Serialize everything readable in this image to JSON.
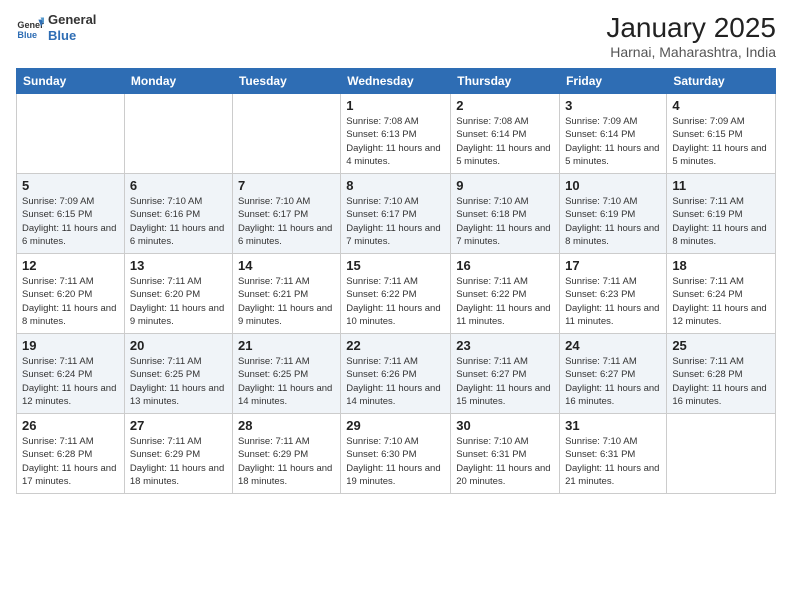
{
  "logo": {
    "general": "General",
    "blue": "Blue"
  },
  "title": "January 2025",
  "subtitle": "Harnai, Maharashtra, India",
  "days_of_week": [
    "Sunday",
    "Monday",
    "Tuesday",
    "Wednesday",
    "Thursday",
    "Friday",
    "Saturday"
  ],
  "weeks": [
    [
      {
        "day": "",
        "info": ""
      },
      {
        "day": "",
        "info": ""
      },
      {
        "day": "",
        "info": ""
      },
      {
        "day": "1",
        "info": "Sunrise: 7:08 AM\nSunset: 6:13 PM\nDaylight: 11 hours and 4 minutes."
      },
      {
        "day": "2",
        "info": "Sunrise: 7:08 AM\nSunset: 6:14 PM\nDaylight: 11 hours and 5 minutes."
      },
      {
        "day": "3",
        "info": "Sunrise: 7:09 AM\nSunset: 6:14 PM\nDaylight: 11 hours and 5 minutes."
      },
      {
        "day": "4",
        "info": "Sunrise: 7:09 AM\nSunset: 6:15 PM\nDaylight: 11 hours and 5 minutes."
      }
    ],
    [
      {
        "day": "5",
        "info": "Sunrise: 7:09 AM\nSunset: 6:15 PM\nDaylight: 11 hours and 6 minutes."
      },
      {
        "day": "6",
        "info": "Sunrise: 7:10 AM\nSunset: 6:16 PM\nDaylight: 11 hours and 6 minutes."
      },
      {
        "day": "7",
        "info": "Sunrise: 7:10 AM\nSunset: 6:17 PM\nDaylight: 11 hours and 6 minutes."
      },
      {
        "day": "8",
        "info": "Sunrise: 7:10 AM\nSunset: 6:17 PM\nDaylight: 11 hours and 7 minutes."
      },
      {
        "day": "9",
        "info": "Sunrise: 7:10 AM\nSunset: 6:18 PM\nDaylight: 11 hours and 7 minutes."
      },
      {
        "day": "10",
        "info": "Sunrise: 7:10 AM\nSunset: 6:19 PM\nDaylight: 11 hours and 8 minutes."
      },
      {
        "day": "11",
        "info": "Sunrise: 7:11 AM\nSunset: 6:19 PM\nDaylight: 11 hours and 8 minutes."
      }
    ],
    [
      {
        "day": "12",
        "info": "Sunrise: 7:11 AM\nSunset: 6:20 PM\nDaylight: 11 hours and 8 minutes."
      },
      {
        "day": "13",
        "info": "Sunrise: 7:11 AM\nSunset: 6:20 PM\nDaylight: 11 hours and 9 minutes."
      },
      {
        "day": "14",
        "info": "Sunrise: 7:11 AM\nSunset: 6:21 PM\nDaylight: 11 hours and 9 minutes."
      },
      {
        "day": "15",
        "info": "Sunrise: 7:11 AM\nSunset: 6:22 PM\nDaylight: 11 hours and 10 minutes."
      },
      {
        "day": "16",
        "info": "Sunrise: 7:11 AM\nSunset: 6:22 PM\nDaylight: 11 hours and 11 minutes."
      },
      {
        "day": "17",
        "info": "Sunrise: 7:11 AM\nSunset: 6:23 PM\nDaylight: 11 hours and 11 minutes."
      },
      {
        "day": "18",
        "info": "Sunrise: 7:11 AM\nSunset: 6:24 PM\nDaylight: 11 hours and 12 minutes."
      }
    ],
    [
      {
        "day": "19",
        "info": "Sunrise: 7:11 AM\nSunset: 6:24 PM\nDaylight: 11 hours and 12 minutes."
      },
      {
        "day": "20",
        "info": "Sunrise: 7:11 AM\nSunset: 6:25 PM\nDaylight: 11 hours and 13 minutes."
      },
      {
        "day": "21",
        "info": "Sunrise: 7:11 AM\nSunset: 6:25 PM\nDaylight: 11 hours and 14 minutes."
      },
      {
        "day": "22",
        "info": "Sunrise: 7:11 AM\nSunset: 6:26 PM\nDaylight: 11 hours and 14 minutes."
      },
      {
        "day": "23",
        "info": "Sunrise: 7:11 AM\nSunset: 6:27 PM\nDaylight: 11 hours and 15 minutes."
      },
      {
        "day": "24",
        "info": "Sunrise: 7:11 AM\nSunset: 6:27 PM\nDaylight: 11 hours and 16 minutes."
      },
      {
        "day": "25",
        "info": "Sunrise: 7:11 AM\nSunset: 6:28 PM\nDaylight: 11 hours and 16 minutes."
      }
    ],
    [
      {
        "day": "26",
        "info": "Sunrise: 7:11 AM\nSunset: 6:28 PM\nDaylight: 11 hours and 17 minutes."
      },
      {
        "day": "27",
        "info": "Sunrise: 7:11 AM\nSunset: 6:29 PM\nDaylight: 11 hours and 18 minutes."
      },
      {
        "day": "28",
        "info": "Sunrise: 7:11 AM\nSunset: 6:29 PM\nDaylight: 11 hours and 18 minutes."
      },
      {
        "day": "29",
        "info": "Sunrise: 7:10 AM\nSunset: 6:30 PM\nDaylight: 11 hours and 19 minutes."
      },
      {
        "day": "30",
        "info": "Sunrise: 7:10 AM\nSunset: 6:31 PM\nDaylight: 11 hours and 20 minutes."
      },
      {
        "day": "31",
        "info": "Sunrise: 7:10 AM\nSunset: 6:31 PM\nDaylight: 11 hours and 21 minutes."
      },
      {
        "day": "",
        "info": ""
      }
    ]
  ]
}
